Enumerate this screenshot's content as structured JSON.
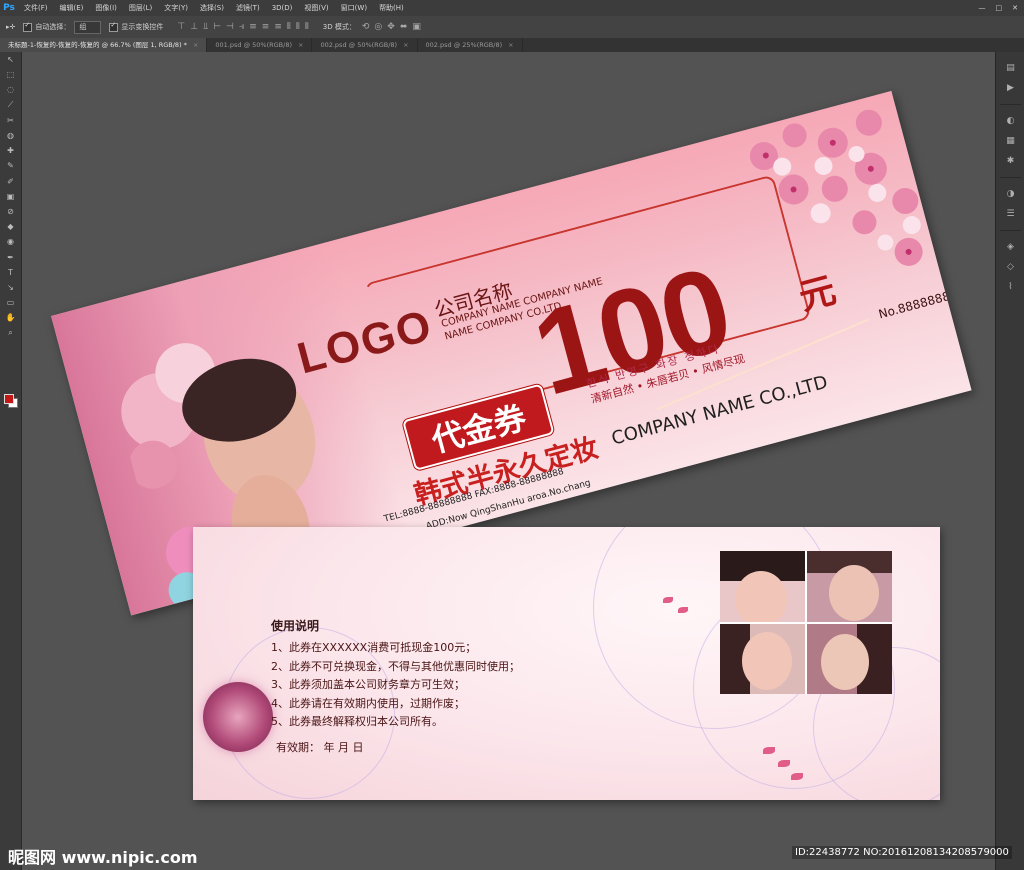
{
  "app": {
    "logo": "Ps",
    "menu": [
      "文件(F)",
      "编辑(E)",
      "图像(I)",
      "图层(L)",
      "文字(Y)",
      "选择(S)",
      "滤镜(T)",
      "3D(D)",
      "视图(V)",
      "窗口(W)",
      "帮助(H)"
    ]
  },
  "options": {
    "auto_select_label": "自动选择：",
    "auto_select_value": "组",
    "show_transform_label": "显示变换控件",
    "mode_3d_label": "3D 模式："
  },
  "tabs": [
    {
      "label": "未标题-1-恢复的-恢复的-恢复的 @ 66.7% (图层 1, RGB/8) *",
      "active": true
    },
    {
      "label": "001.psd @ 50%(RGB/8)",
      "active": false
    },
    {
      "label": "002.psd @ 50%(RGB/8)",
      "active": false
    },
    {
      "label": "002.psd @ 25%(RGB/8)",
      "active": false
    }
  ],
  "tools": [
    "↖",
    "⬚",
    "◌",
    "⟋",
    "✂",
    "◍",
    "✚",
    "✎",
    "✐",
    "▣",
    "⊘",
    "◆",
    "◉",
    "✒",
    "T",
    "↘",
    "▭",
    "✋",
    "⌕"
  ],
  "colors": {
    "foreground": "#c41818",
    "background": "#ffffff",
    "brand_red": "#9b1515",
    "pink": "#f5b9c4"
  },
  "voucher": {
    "logo": "LOGO",
    "company_cn": "公司名称",
    "company_en_line1": "COMPANY NAME COMPANY NAME",
    "company_en_line2": "NAME COMPANY CO.LTD",
    "amount": "100",
    "unit": "元",
    "badge": "代金券",
    "korean": "한식 반영구 화장 정하다",
    "slogan": "清新自然 • 朱唇若贝 • 风情尽现",
    "brand_cn": "韩式半永久定妆",
    "brand_en": "COMPANY NAME CO.,LTD",
    "company_en_line3": "COMPANY NAME CO.,LTD",
    "address": "ADD:Now QingShanHu aroa.No.chang",
    "tel": "TEL:8888-88888888    FAX:8888-88888888",
    "serial": "No.88888888"
  },
  "back": {
    "title": "使用说明",
    "rules": [
      "1、此券在XXXXXX消费可抵现金100元；",
      "2、此券不可兑换现金，不得与其他优惠同时使用；",
      "3、此券须加盖本公司财务章方可生效；",
      "4、此券请在有效期内使用，过期作废；",
      "5、此券最终解释权归本公司所有。"
    ],
    "validity": "有效期：      年    月    日"
  },
  "watermark": {
    "left": "昵图网 www.nipic.com",
    "right": "ID:22438772 NO:20161208134208579000"
  }
}
